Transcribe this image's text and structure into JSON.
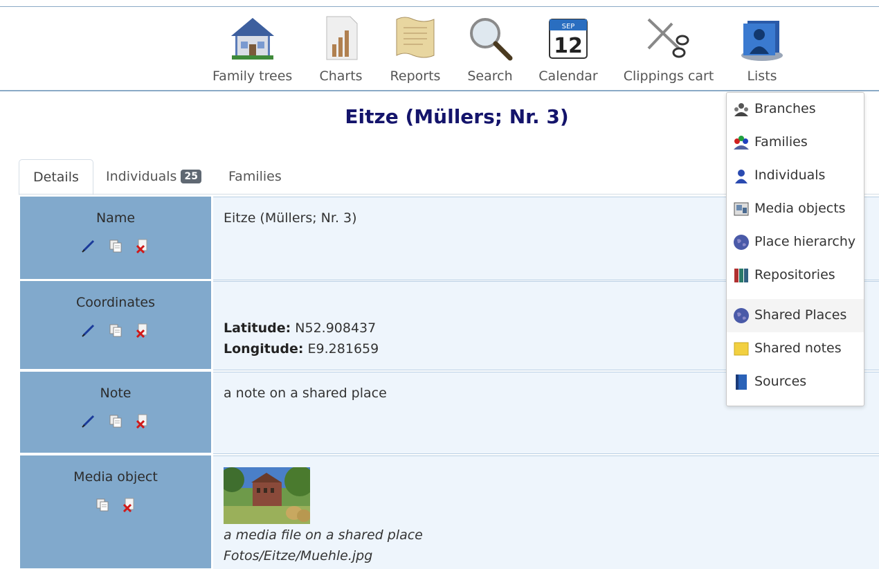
{
  "menu": {
    "items": [
      {
        "label": "Family trees",
        "icon": "house-icon"
      },
      {
        "label": "Charts",
        "icon": "bar-chart-icon"
      },
      {
        "label": "Reports",
        "icon": "scroll-icon"
      },
      {
        "label": "Search",
        "icon": "magnifier-icon"
      },
      {
        "label": "Calendar",
        "icon": "calendar-icon",
        "month": "SEP",
        "day": "12"
      },
      {
        "label": "Clippings cart",
        "icon": "scissors-icon"
      },
      {
        "label": "Lists",
        "icon": "lists-icon"
      }
    ]
  },
  "page": {
    "title": "Eitze (Müllers; Nr. 3)"
  },
  "tabs": [
    {
      "label": "Details"
    },
    {
      "label": "Individuals",
      "badge": "25"
    },
    {
      "label": "Families"
    }
  ],
  "facts": {
    "name": {
      "label": "Name",
      "value": "Eitze (Müllers; Nr. 3)"
    },
    "coordinates": {
      "label": "Coordinates",
      "lat_label": "Latitude:",
      "lat": "N52.908437",
      "lon_label": "Longitude:",
      "lon": "E9.281659"
    },
    "note": {
      "label": "Note",
      "value": "a note on a shared place"
    },
    "media": {
      "label": "Media object",
      "caption": "a media file on a shared place",
      "path": "Fotos/Eitze/Muehle.jpg"
    }
  },
  "lists_menu": [
    {
      "label": "Branches",
      "icon": "branches-icon"
    },
    {
      "label": "Families",
      "icon": "families-icon"
    },
    {
      "label": "Individuals",
      "icon": "individual-icon"
    },
    {
      "label": "Media objects",
      "icon": "media-icon"
    },
    {
      "label": "Place hierarchy",
      "icon": "globe-icon"
    },
    {
      "label": "Repositories",
      "icon": "books-icon"
    },
    {
      "label": "Shared Places",
      "icon": "globe-icon",
      "highlighted": true
    },
    {
      "label": "Shared notes",
      "icon": "note-icon"
    },
    {
      "label": "Sources",
      "icon": "book-icon"
    }
  ],
  "colors": {
    "label_bg": "#81a9cc",
    "value_bg": "#eef5fc",
    "title": "#14146b"
  }
}
